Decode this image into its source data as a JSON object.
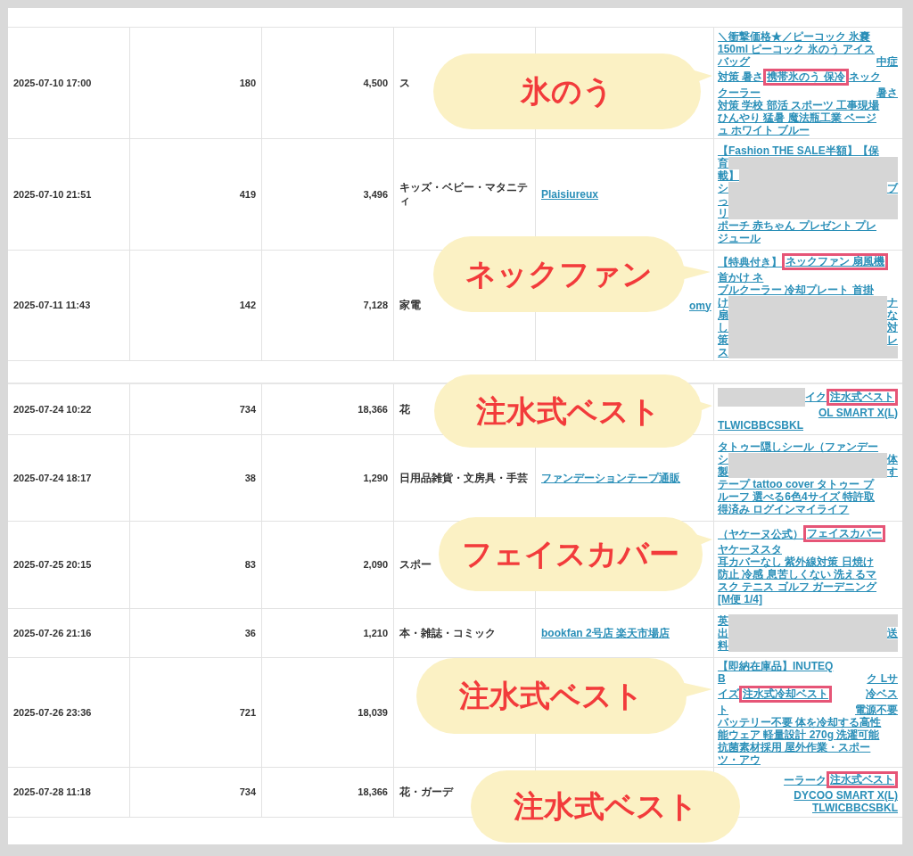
{
  "rows": [
    {
      "datetime": "2025-07-10 17:00",
      "count": "180",
      "amount": "4,500",
      "category": "ス",
      "section_start": false,
      "title_lines": [
        "＼衝撃価格★／ピーコック 氷嚢",
        "150ml ピーコック 氷のう アイス",
        [
          {
            "kind": "text",
            "text": "バッグ",
            "highlighted": false
          },
          {
            "kind": "gap"
          },
          {
            "kind": "text",
            "text": "中症",
            "highlighted": false
          }
        ],
        [
          {
            "kind": "text",
            "text": "対策 暑さ ",
            "highlighted": false
          },
          {
            "kind": "text",
            "text": "携帯氷のう 保冷",
            "highlighted": true
          },
          {
            "kind": "text",
            "text": " ネック",
            "highlighted": false
          }
        ],
        [
          {
            "kind": "text",
            "text": "クーラー",
            "highlighted": false
          },
          {
            "kind": "gap"
          },
          {
            "kind": "text",
            "text": "暑さ",
            "highlighted": false
          }
        ],
        "対策 学校 部活 スポーツ 工事現場",
        "ひんやり 猛暑 魔法瓶工業 ベージ",
        "ュ ホワイト ブルー"
      ]
    },
    {
      "datetime": "2025-07-10 21:51",
      "count": "419",
      "amount": "3,496",
      "category": "キッズ・ベビー・マタニティ",
      "shop": "Plaisiureux",
      "section_start": false,
      "title_lines": [
        "【Fashion THE SALE半額】【保",
        [
          {
            "kind": "text",
            "text": "育",
            "highlighted": false
          },
          {
            "kind": "redacted"
          }
        ],
        [
          {
            "kind": "text",
            "text": "載】",
            "highlighted": false
          },
          {
            "kind": "redacted"
          }
        ],
        [
          {
            "kind": "text",
            "text": "シ",
            "highlighted": false
          },
          {
            "kind": "redacted"
          },
          {
            "kind": "text",
            "text": "ブ",
            "highlighted": false
          }
        ],
        [
          {
            "kind": "text",
            "text": "っ",
            "highlighted": false
          },
          {
            "kind": "redacted"
          }
        ],
        [
          {
            "kind": "text",
            "text": "リ",
            "highlighted": false
          },
          {
            "kind": "redacted"
          }
        ],
        "ポーチ 赤ちゃん プレゼント プレ",
        "ジュール"
      ]
    },
    {
      "datetime": "2025-07-11 11:43",
      "count": "142",
      "amount": "7,128",
      "category": "家電",
      "shop": "omy",
      "section_start": false,
      "title_lines": [
        [
          {
            "kind": "text",
            "text": "【特典付き】",
            "highlighted": false
          },
          {
            "kind": "text",
            "text": "ネックファン 扇風機",
            "highlighted": true
          }
        ],
        [
          {
            "kind": "text",
            "text": "首かけ ネ",
            "highlighted": false
          },
          {
            "kind": "gap"
          }
        ],
        "ブルクーラー 冷却プレート 首掛",
        [
          {
            "kind": "text",
            "text": "け",
            "highlighted": false
          },
          {
            "kind": "redacted"
          },
          {
            "kind": "text",
            "text": "ナ",
            "highlighted": false
          }
        ],
        [
          {
            "kind": "text",
            "text": "扇",
            "highlighted": false
          },
          {
            "kind": "redacted"
          },
          {
            "kind": "text",
            "text": "な",
            "highlighted": false
          }
        ],
        [
          {
            "kind": "text",
            "text": "し",
            "highlighted": false
          },
          {
            "kind": "redacted"
          },
          {
            "kind": "text",
            "text": "対",
            "highlighted": false
          }
        ],
        [
          {
            "kind": "text",
            "text": "策",
            "highlighted": false
          },
          {
            "kind": "redacted"
          },
          {
            "kind": "text",
            "text": "レ",
            "highlighted": false
          }
        ],
        [
          {
            "kind": "text",
            "text": "ス",
            "highlighted": false
          },
          {
            "kind": "redacted"
          }
        ]
      ]
    },
    {
      "datetime": "2025-07-24 10:22",
      "count": "734",
      "amount": "18,366",
      "category": "花",
      "section_start": true,
      "title_lines": [
        [
          {
            "kind": "redacted"
          },
          {
            "kind": "text",
            "text": "イク ",
            "highlighted": false
          },
          {
            "kind": "text",
            "text": "注水式ベスト",
            "highlighted": true
          }
        ],
        [
          {
            "kind": "gap"
          },
          {
            "kind": "text",
            "text": "OL SMART X(L)",
            "highlighted": false
          }
        ],
        "TLWICBBCSBKL"
      ]
    },
    {
      "datetime": "2025-07-24 18:17",
      "count": "38",
      "amount": "1,290",
      "category": "日用品雑貨・文房具・手芸",
      "shop": "ファンデーションテープ通販",
      "section_start": false,
      "title_lines": [
        "タトゥー隠しシール（ファンデー",
        [
          {
            "kind": "text",
            "text": "シ",
            "highlighted": false
          },
          {
            "kind": "redacted"
          },
          {
            "kind": "text",
            "text": "体",
            "highlighted": false
          }
        ],
        [
          {
            "kind": "text",
            "text": "製",
            "highlighted": false
          },
          {
            "kind": "redacted"
          },
          {
            "kind": "text",
            "text": "す",
            "highlighted": false
          }
        ],
        "テープ tattoo cover タトゥー プ",
        "ルーフ 選べる6色4サイズ 特許取",
        "得済み ログインマイライフ"
      ]
    },
    {
      "datetime": "2025-07-25 20:15",
      "count": "83",
      "amount": "2,090",
      "category": "スポー",
      "section_start": false,
      "title_lines": [
        [
          {
            "kind": "text",
            "text": "（ヤケーヌ公式）",
            "highlighted": false
          },
          {
            "kind": "text",
            "text": "フェイスカバー",
            "highlighted": true
          }
        ],
        [
          {
            "kind": "text",
            "text": "ヤケーヌスタ",
            "highlighted": false
          },
          {
            "kind": "gap"
          }
        ],
        "耳カバーなし 紫外線対策 日焼け",
        "防止 冷感 息苦しくない 洗えるマ",
        "スク テニス ゴルフ ガーデニング",
        "[M便 1/4]"
      ]
    },
    {
      "datetime": "2025-07-26 21:16",
      "count": "36",
      "amount": "1,210",
      "category": "本・雑誌・コミック",
      "shop": "bookfan 2号店 楽天市場店",
      "section_start": false,
      "title_lines": [
        [
          {
            "kind": "text",
            "text": "英",
            "highlighted": false
          },
          {
            "kind": "redacted"
          }
        ],
        [
          {
            "kind": "text",
            "text": "出",
            "highlighted": false
          },
          {
            "kind": "redacted"
          },
          {
            "kind": "text",
            "text": "送",
            "highlighted": false
          }
        ],
        [
          {
            "kind": "text",
            "text": "料",
            "highlighted": false
          },
          {
            "kind": "redacted"
          }
        ]
      ]
    },
    {
      "datetime": "2025-07-26 23:36",
      "count": "721",
      "amount": "18,039",
      "section_start": false,
      "title_lines": [
        "【即納在庫品】INUTEQ",
        [
          {
            "kind": "text",
            "text": "B",
            "highlighted": false
          },
          {
            "kind": "gap"
          },
          {
            "kind": "text",
            "text": "ク Lサ",
            "highlighted": false
          }
        ],
        [
          {
            "kind": "text",
            "text": "イズ ",
            "highlighted": false
          },
          {
            "kind": "text",
            "text": "注水式冷却ベスト",
            "highlighted": true
          },
          {
            "kind": "gap"
          },
          {
            "kind": "text",
            "text": "冷ベス",
            "highlighted": false
          }
        ],
        [
          {
            "kind": "text",
            "text": "ト",
            "highlighted": false
          },
          {
            "kind": "gap"
          },
          {
            "kind": "text",
            "text": "電源不要",
            "highlighted": false
          }
        ],
        "バッテリー不要 体を冷却する高性",
        "能ウェア 軽量設計 270g 洗濯可能",
        "抗菌素材採用 屋外作業・スポー",
        "ツ・アウ"
      ]
    },
    {
      "datetime": "2025-07-28 11:18",
      "count": "734",
      "amount": "18,366",
      "category": "花・ガーデ",
      "section_start": false,
      "title_lines": [
        [
          {
            "kind": "gap"
          },
          {
            "kind": "text",
            "text": "ーラーク ",
            "highlighted": false
          },
          {
            "kind": "text",
            "text": "注水式ベスト",
            "highlighted": true
          }
        ],
        [
          {
            "kind": "gap"
          },
          {
            "kind": "text",
            "text": "DYCOO SMART X(L)",
            "highlighted": false
          }
        ],
        [
          {
            "kind": "gap"
          },
          {
            "kind": "text",
            "text": "TLWICBBCSBKL",
            "highlighted": false
          }
        ]
      ]
    }
  ],
  "callouts": [
    "氷のう",
    "ネックファン",
    "注水式ベスト",
    "フェイスカバー",
    "注水式ベスト",
    "注水式ベスト"
  ]
}
